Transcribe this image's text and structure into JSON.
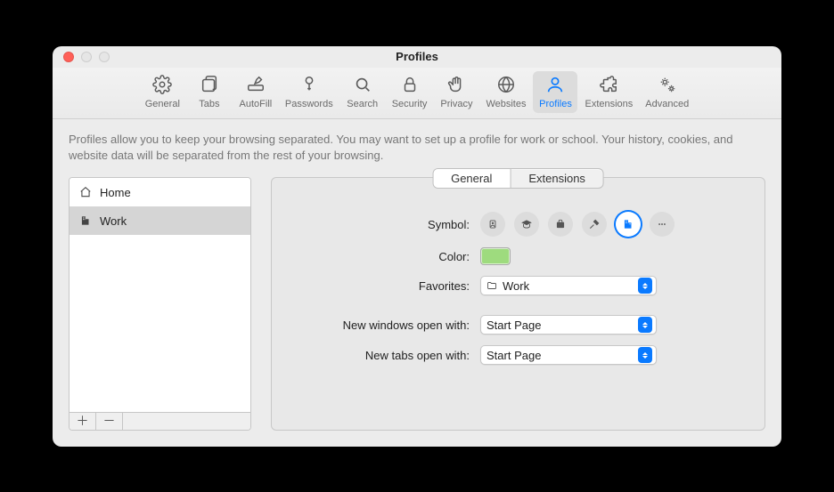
{
  "window": {
    "title": "Profiles"
  },
  "toolbar": {
    "items": [
      {
        "label": "General"
      },
      {
        "label": "Tabs"
      },
      {
        "label": "AutoFill"
      },
      {
        "label": "Passwords"
      },
      {
        "label": "Search"
      },
      {
        "label": "Security"
      },
      {
        "label": "Privacy"
      },
      {
        "label": "Websites"
      },
      {
        "label": "Profiles"
      },
      {
        "label": "Extensions"
      },
      {
        "label": "Advanced"
      }
    ],
    "selected_index": 8
  },
  "description": "Profiles allow you to keep your browsing separated. You may want to set up a profile for work or school. Your history, cookies, and website data will be separated from the rest of your browsing.",
  "sidebar": {
    "items": [
      {
        "label": "Home",
        "icon": "home-icon"
      },
      {
        "label": "Work",
        "icon": "building-icon"
      }
    ],
    "selected_index": 1
  },
  "segmented": {
    "tabs": [
      "General",
      "Extensions"
    ],
    "selected_index": 0
  },
  "form": {
    "symbol_label": "Symbol:",
    "color_label": "Color:",
    "favorites_label": "Favorites:",
    "new_windows_label": "New windows open with:",
    "new_tabs_label": "New tabs open with:",
    "symbols": [
      "id-card-icon",
      "graduation-cap-icon",
      "briefcase-icon",
      "hammer-icon",
      "building-icon",
      "ellipsis-icon"
    ],
    "symbol_selected_index": 4,
    "color_value": "#9edb7e",
    "favorites_value": "Work",
    "new_windows_value": "Start Page",
    "new_tabs_value": "Start Page"
  }
}
